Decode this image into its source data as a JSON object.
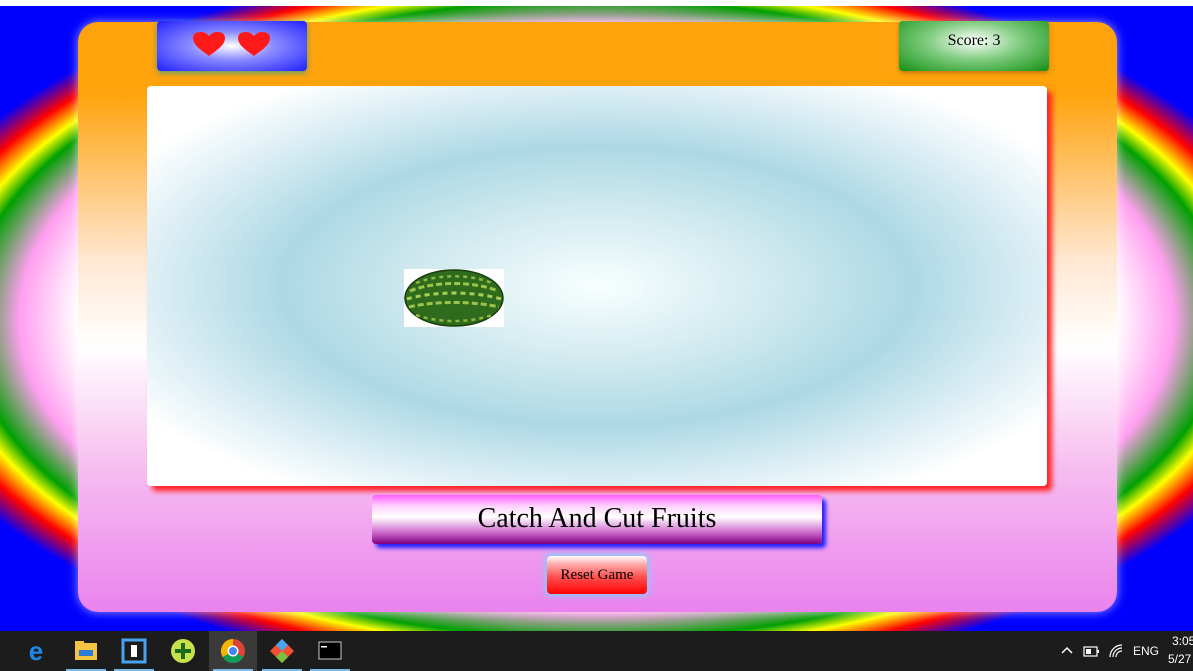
{
  "game": {
    "lives": 2,
    "lives_icon": "heart-icon",
    "score_text": "Score: 3",
    "fruit": "watermelon",
    "title": "Catch And Cut Fruits",
    "reset_label": "Reset Game"
  },
  "taskbar": {
    "apps": [
      {
        "name": "edge-icon"
      },
      {
        "name": "file-explorer-icon"
      },
      {
        "name": "store-icon"
      },
      {
        "name": "plus-app-icon"
      },
      {
        "name": "chrome-icon",
        "active": true
      },
      {
        "name": "git-icon"
      },
      {
        "name": "terminal-icon"
      }
    ],
    "tray": {
      "language": "ENG",
      "time": "3:05",
      "date": "5/27"
    }
  },
  "colors": {
    "heart": "#ff1a1a",
    "lives_box": "#2020ff",
    "score_box": "#139013",
    "play_area_shadow": "#ff2020",
    "reset_button": "#ff0000"
  }
}
